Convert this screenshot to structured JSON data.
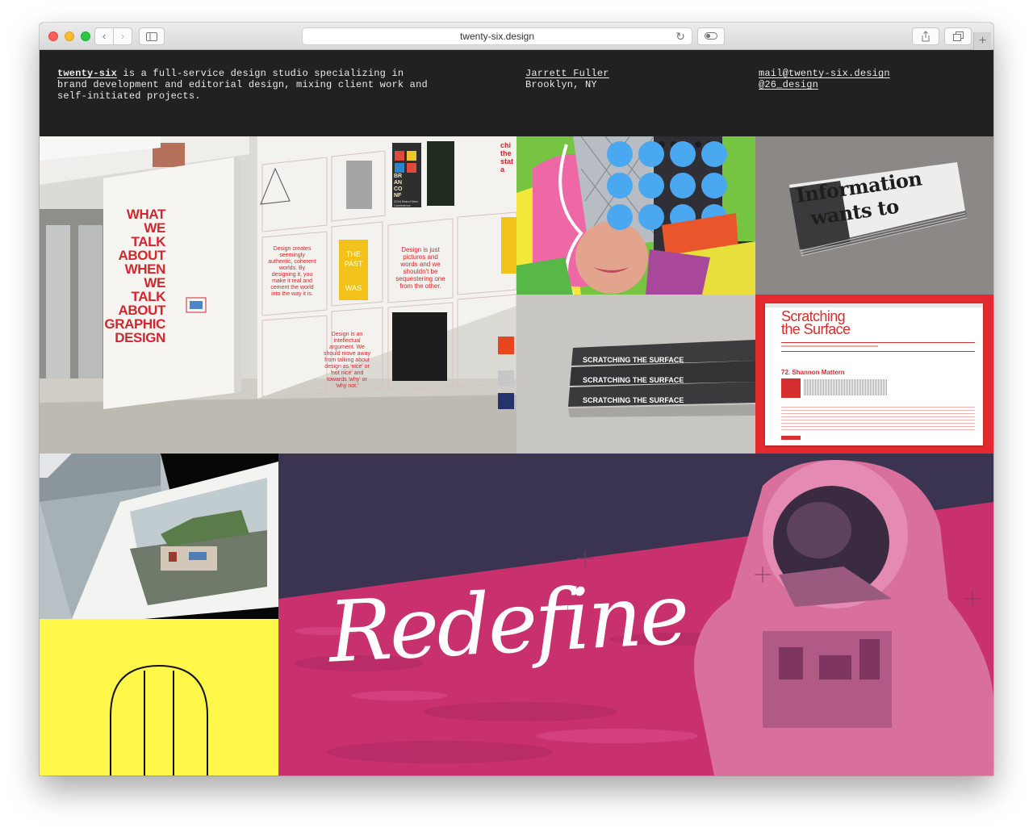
{
  "browser": {
    "url": "twenty-six.design"
  },
  "header": {
    "studio_name": "twenty-six",
    "intro_rest": " is a full-service design studio specializing in brand development and editorial design, mixing client work and self-initiated projects.",
    "person_name": "Jarrett Fuller",
    "location": "Brooklyn, NY",
    "email": "mail@twenty-six.design",
    "handle": "@26_design"
  },
  "tiles": {
    "exhibit": {
      "headline": [
        "WHAT",
        "WE",
        "TALK",
        "ABOUT",
        "WHEN",
        "WE",
        "TALK",
        "ABOUT",
        "GRAPHIC",
        "DESIGN"
      ],
      "poster1": "Design creates seemingly authentic, coherent worlds. By designing it, you make it real and cement the world into the way it is.",
      "poster2": "Design is just pictures and words and we shouldn't be sequestering one from the other.",
      "poster3": "Design is an intellectual argument. We should move away from talking about design as 'nice' or 'not nice' and towards 'why' or 'why not.'",
      "yellow_poster": [
        "THE",
        "PAST",
        "WAS"
      ],
      "top_poster": [
        "BR",
        "AN",
        "CO",
        "NF"
      ],
      "top_poster_sub": "2016 Brand New Conference",
      "right_poster": [
        "chi",
        "the",
        "stat",
        "a"
      ]
    },
    "newspaper": {
      "line1": "Information",
      "line2": "wants to"
    },
    "books": {
      "spine_title": "SCRATCHING THE SURFACE"
    },
    "podcast": {
      "title_line1": "Scratching",
      "title_line2": "the Surface",
      "episode": "72. Shannon Mattern"
    },
    "redefine": {
      "script_word": "Redefine"
    }
  },
  "colors": {
    "header_bg": "#212121",
    "accent_red": "#d4262c",
    "pink": "#d8337a",
    "navy": "#3a3450",
    "yellow": "#fff84a"
  }
}
